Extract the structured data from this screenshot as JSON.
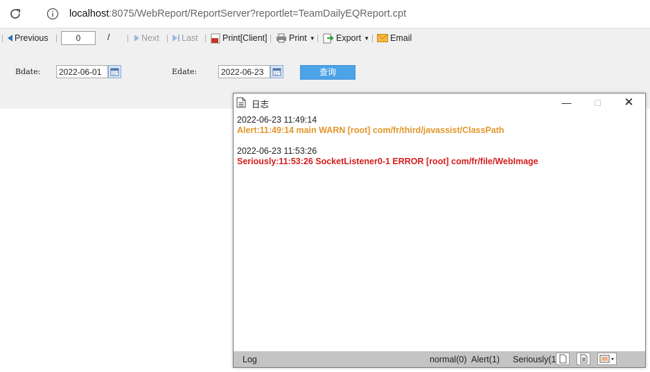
{
  "browser": {
    "url_host": "localhost",
    "url_rest": ":8075/WebReport/ReportServer?reportlet=TeamDailyEQReport.cpt"
  },
  "toolbar": {
    "previous": "Previous",
    "page_value": "0",
    "page_sep": "/",
    "next": "Next",
    "last": "Last",
    "print_client": "Print[Client]",
    "print": "Print",
    "export": "Export",
    "email": "Email"
  },
  "params": {
    "bdate_label": "Bdate:",
    "bdate_value": "2022-06-01",
    "edate_label": "Edate:",
    "edate_value": "2022-06-23",
    "query": "查询"
  },
  "dialog": {
    "title": "日志",
    "entries": [
      {
        "time": "2022-06-23 11:49:14",
        "message": "Alert:11:49:14 main WARN [root] com/fr/third/javassist/ClassPath"
      },
      {
        "time": "2022-06-23 11:53:26",
        "message": "Seriously:11:53:26 SocketListener0-1 ERROR [root] com/fr/file/WebImage"
      }
    ],
    "status": {
      "log_label": "Log",
      "normal": "normal(0)",
      "alert": "Alert(1)",
      "seriously": "Seriously(1"
    }
  },
  "colors": {
    "alert": "#e3962b",
    "serious": "#d41c1c",
    "query_button": "#4da3e8"
  }
}
